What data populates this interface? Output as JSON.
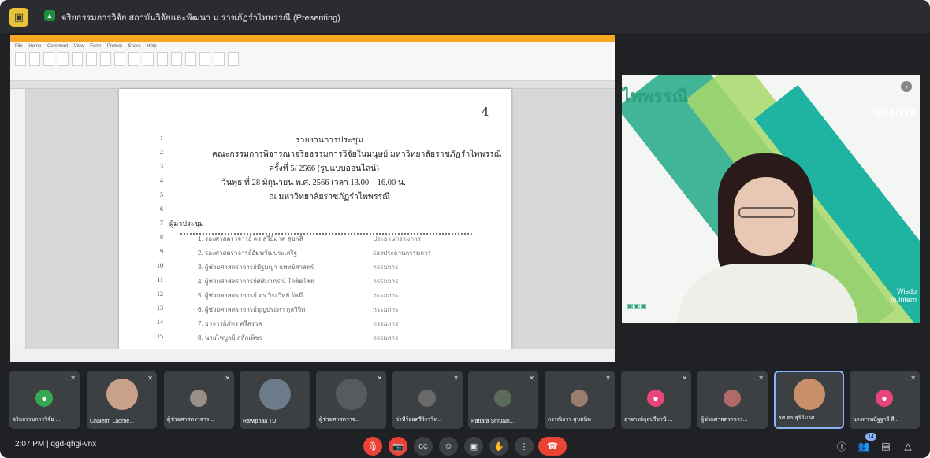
{
  "meeting": {
    "title": "จริยธรรมการวิจัย สถาบันวิจัยและพัฒนา ม.ราชภัฏรำไพพรรณี (Presenting)",
    "time": "2:07 PM",
    "separator": "|",
    "code": "qgd-qhgi-vnx",
    "participant_count": "14"
  },
  "document": {
    "page_number": "4",
    "line_numbers": [
      "1",
      "2",
      "3",
      "4",
      "5",
      "6",
      "7",
      "8",
      "9",
      "10",
      "11",
      "12",
      "13",
      "14",
      "15"
    ],
    "heading1": "รายงานการประชุม",
    "heading2": "คณะกรรมการพิจารณาจริยธรรมการวิจัยในมนุษย์ มหาวิทยาลัยราชภัฏรำไพพรรณี",
    "heading3": "ครั้งที่ 5/ 2566 (รูปแบบออนไลน์)",
    "heading4": "วันพุธ ที่ 28 มิถุนายน พ.ศ. 2566  เวลา 13.00 – 16.00 น.",
    "heading5": "ณ มหาวิทยาลัยราชภัฏรำไพพรรณี",
    "attendees_label": "ผู้มาประชุม",
    "members": [
      {
        "name": "1. รองศาสตราจารย์ ดร.สุรีย์มาศ สุขกสิ",
        "role": "ประธานกรรมการ"
      },
      {
        "name": "2. รองศาสตราจารย์อัมพวัน ประเสริฐ",
        "role": "รองประธานกรรมการ"
      },
      {
        "name": "3. ผู้ช่วยศาสตราจารย์ปัฐมญา แพทย์ศาสตร์",
        "role": "กรรมการ"
      },
      {
        "name": "4. ผู้ช่วยศาสตราจารย์ศศิมาภรณ์ โอชิตไชย",
        "role": "กรรมการ"
      },
      {
        "name": "5. ผู้ช่วยศาสตราจารย์ ดร.วิระวิทย์ รัศมี",
        "role": "กรรมการ"
      },
      {
        "name": "6. ผู้ช่วยศาสตราจารย์บุญประภา กุลวิจิต",
        "role": "กรรมการ"
      },
      {
        "name": "7. อาจารย์ภัทร ศรีสรวล",
        "role": "กรรมการ"
      },
      {
        "name": "8. นายไพบูลย์ สลักเพ็ชร",
        "role": "กรรมการ"
      }
    ]
  },
  "speaker": {
    "brand_left": "ไพพรรณี",
    "brand_right": "แห่งภาค",
    "footer_right_1": "Wisdo",
    "footer_right_2": "to Intern"
  },
  "participants": [
    {
      "name": "จริยธรรมการวิจัย ...",
      "color": "#34a853"
    },
    {
      "name": "Chalerm Laorne...",
      "color": "#c9a08a"
    },
    {
      "name": "ผู้ช่วยศาสตราจาร...",
      "color": "#9a8f86"
    },
    {
      "name": "Rawiphaa TD",
      "color": "#6d7c8a"
    },
    {
      "name": "ผู้ช่วยศาสตราจ...",
      "color": "#555b60"
    },
    {
      "name": "ว่าที่ร้อยตรีวิรววิท...",
      "color": "#6a6a6a"
    },
    {
      "name": "Pattara Sriruaal...",
      "color": "#5b6b5a"
    },
    {
      "name": "กรรณิการ สุขสนิท",
      "color": "#9a7c70"
    },
    {
      "name": "อาจารย์กุลปรียานี ...",
      "color": "#e8457a"
    },
    {
      "name": "ผู้ช่วยศาสตราจาร...",
      "color": "#b06a6a"
    },
    {
      "name": "รศ.ดร.สุรีย์มาศ ...",
      "color": "#c98e6a"
    },
    {
      "name": "นางสาวณัฐฐาวี สี...",
      "color": "#e8457a"
    }
  ],
  "controls": {
    "mic_icon": "🎙",
    "camera_icon": "📷",
    "cc_icon": "CC",
    "emoji_icon": "☺",
    "present_icon": "▣",
    "hand_icon": "✋",
    "more_icon": "⋮",
    "end_icon": "☎",
    "info_icon": "ⓘ",
    "people_icon": "👥",
    "chat_icon": "▤",
    "activities_icon": "△"
  }
}
